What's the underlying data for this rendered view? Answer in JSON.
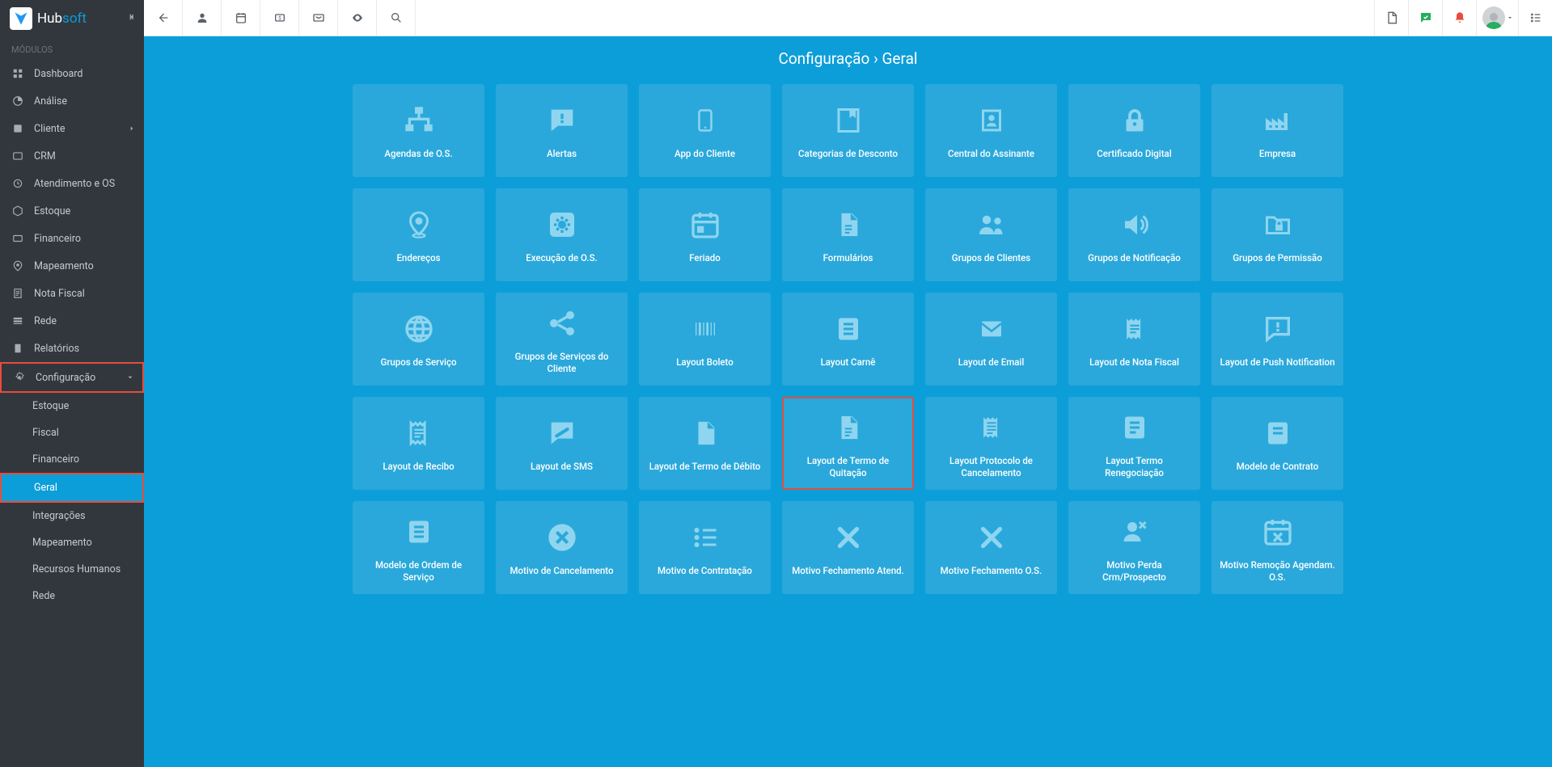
{
  "logo": {
    "hub": "Hub",
    "soft": "soft"
  },
  "sidebar": {
    "section": "MÓDULOS",
    "items": [
      {
        "label": "Dashboard"
      },
      {
        "label": "Análise"
      },
      {
        "label": "Cliente"
      },
      {
        "label": "CRM"
      },
      {
        "label": "Atendimento e OS"
      },
      {
        "label": "Estoque"
      },
      {
        "label": "Financeiro"
      },
      {
        "label": "Mapeamento"
      },
      {
        "label": "Nota Fiscal"
      },
      {
        "label": "Rede"
      },
      {
        "label": "Relatórios"
      },
      {
        "label": "Configuração"
      }
    ],
    "subs": [
      {
        "label": "Estoque"
      },
      {
        "label": "Fiscal"
      },
      {
        "label": "Financeiro"
      },
      {
        "label": "Geral"
      },
      {
        "label": "Integrações"
      },
      {
        "label": "Mapeamento"
      },
      {
        "label": "Recursos Humanos"
      },
      {
        "label": "Rede"
      }
    ]
  },
  "breadcrumb": "Configuração › Geral",
  "cards": [
    {
      "label": "Agendas de O.S."
    },
    {
      "label": "Alertas"
    },
    {
      "label": "App do Cliente"
    },
    {
      "label": "Categorias de Desconto"
    },
    {
      "label": "Central do Assinante"
    },
    {
      "label": "Certificado Digital"
    },
    {
      "label": "Empresa"
    },
    {
      "label": "Endereços"
    },
    {
      "label": "Execução de O.S."
    },
    {
      "label": "Feriado"
    },
    {
      "label": "Formulários"
    },
    {
      "label": "Grupos de Clientes"
    },
    {
      "label": "Grupos de Notificação"
    },
    {
      "label": "Grupos de Permissão"
    },
    {
      "label": "Grupos de Serviço"
    },
    {
      "label": "Grupos de Serviços do Cliente"
    },
    {
      "label": "Layout Boleto"
    },
    {
      "label": "Layout Carnê"
    },
    {
      "label": "Layout de Email"
    },
    {
      "label": "Layout de Nota Fiscal"
    },
    {
      "label": "Layout de Push Notification"
    },
    {
      "label": "Layout de Recibo"
    },
    {
      "label": "Layout de SMS"
    },
    {
      "label": "Layout de Termo de Débito"
    },
    {
      "label": "Layout de Termo de Quitação"
    },
    {
      "label": "Layout Protocolo de Cancelamento"
    },
    {
      "label": "Layout Termo Renegociação"
    },
    {
      "label": "Modelo de Contrato"
    },
    {
      "label": "Modelo de Ordem de Serviço"
    },
    {
      "label": "Motivo de Cancelamento"
    },
    {
      "label": "Motivo de Contratação"
    },
    {
      "label": "Motivo Fechamento Atend."
    },
    {
      "label": "Motivo Fechamento O.S."
    },
    {
      "label": "Motivo Perda Crm/Prospecto"
    },
    {
      "label": "Motivo Remoção Agendam. O.S."
    }
  ]
}
